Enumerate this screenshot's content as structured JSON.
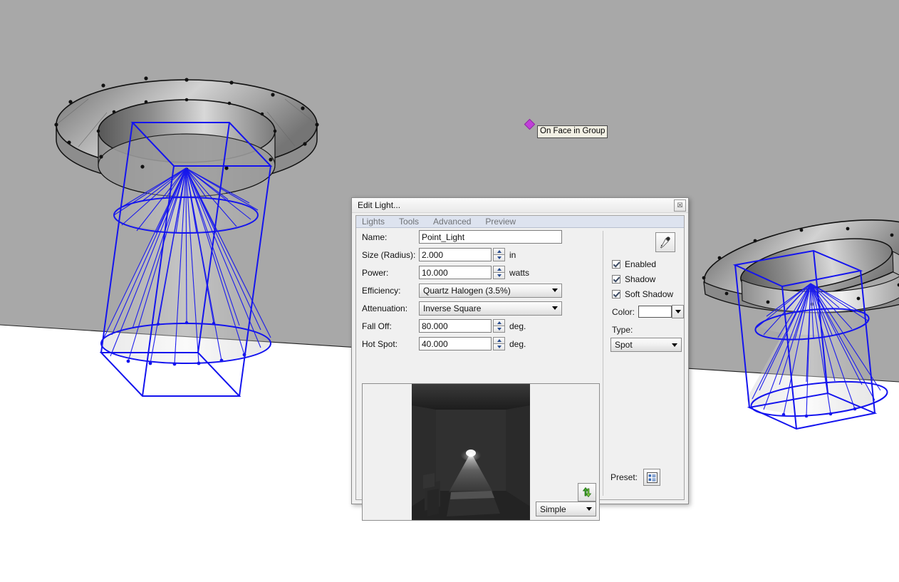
{
  "scene": {
    "wall_color": "#a8a8a8",
    "floor_color": "#ffffff",
    "wireframe_color": "#1414ee",
    "fixture_outline_color": "#111111",
    "inference": {
      "tooltip_text": "On Face in Group",
      "marker_color": "#c040d8",
      "marker_name": "vertex-inference-marker"
    }
  },
  "dialog": {
    "title": "Edit Light...",
    "close_label": "☒",
    "menu": [
      {
        "label": "Lights"
      },
      {
        "label": "Tools"
      },
      {
        "label": "Advanced"
      },
      {
        "label": "Preview"
      }
    ],
    "fields": {
      "name": {
        "label": "Name:",
        "value": "Point_Light",
        "placeholder": ""
      },
      "size_radius": {
        "label": "Size (Radius):",
        "value": "2.000",
        "unit": "in"
      },
      "power": {
        "label": "Power:",
        "value": "10.000",
        "unit": "watts"
      },
      "efficiency": {
        "label": "Efficiency:",
        "value": "Quartz Halogen (3.5%)"
      },
      "attenuation": {
        "label": "Attenuation:",
        "value": "Inverse Square"
      },
      "fall_off": {
        "label": "Fall Off:",
        "value": "80.000",
        "unit": "deg."
      },
      "hot_spot": {
        "label": "Hot Spot:",
        "value": "40.000",
        "unit": "deg."
      }
    },
    "right_panel": {
      "eyedropper_name": "eyedropper-icon",
      "checkboxes": [
        {
          "label": "Enabled",
          "checked": true
        },
        {
          "label": "Shadow",
          "checked": true
        },
        {
          "label": "Soft Shadow",
          "checked": true
        }
      ],
      "color": {
        "label": "Color:",
        "value": "#ffffff"
      },
      "type": {
        "label": "Type:",
        "value": "Spot"
      }
    },
    "preview": {
      "quality_value": "Simple",
      "refresh_icon": "refresh-arrows-icon",
      "preset_label": "Preset:",
      "preset_icon": "preset-list-icon"
    }
  }
}
